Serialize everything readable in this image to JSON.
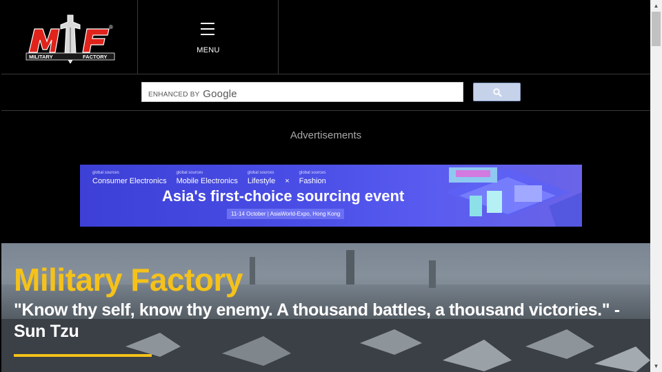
{
  "header": {
    "logo_text_left": "MILITARY",
    "logo_text_right": "FACTORY",
    "logo_registered": "®",
    "menu_label": "MENU"
  },
  "search": {
    "brand_prefix": "ENHANCED BY",
    "brand_name": "Google",
    "placeholder": "",
    "button_icon": "search-icon"
  },
  "ads": {
    "label": "Advertisements",
    "banner": {
      "brands": [
        {
          "small": "global sources",
          "name": "Consumer Electronics"
        },
        {
          "small": "global sources",
          "name": "Mobile Electronics"
        },
        {
          "small": "global sources",
          "name": "Lifestyle"
        },
        {
          "small": "global sources",
          "name": "Fashion"
        }
      ],
      "separator": "×",
      "headline": "Asia's first-choice sourcing event",
      "subline": "11-14 October | AsiaWorld-Expo, Hong Kong"
    }
  },
  "hero": {
    "title": "Military Factory",
    "quote": "\"Know thy self, know thy enemy. A thousand battles, a thousand victories.\" - Sun Tzu"
  },
  "colors": {
    "background": "#000000",
    "accent": "#f5c21b",
    "logo_red": "#e0241b",
    "ad_blue": "#4a4ee6"
  }
}
